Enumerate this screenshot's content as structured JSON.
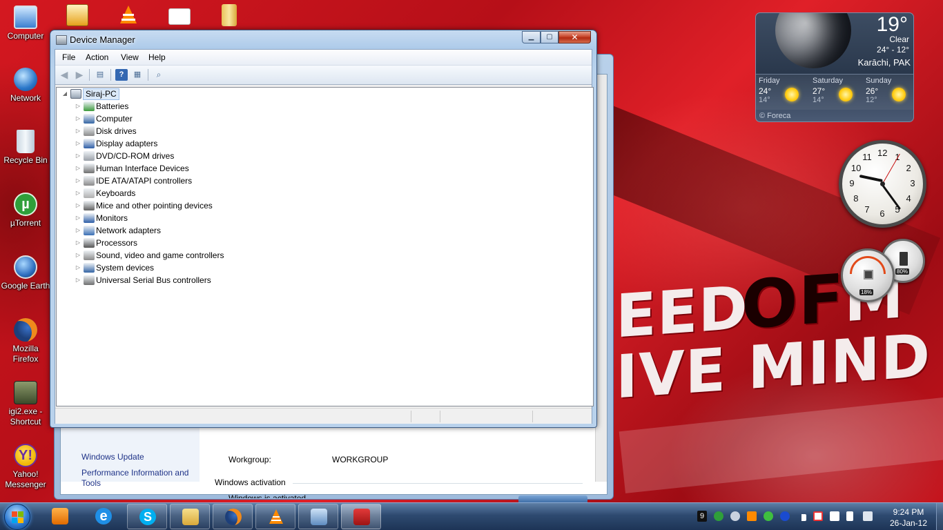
{
  "desktop": {
    "icons": [
      {
        "label": "Computer",
        "icon": "computer-icon"
      },
      {
        "label": "Network",
        "icon": "network-icon"
      },
      {
        "label": "Recycle Bin",
        "icon": "recycle-bin-icon"
      },
      {
        "label": "µTorrent",
        "icon": "utorrent-icon"
      },
      {
        "label": "Google Earth",
        "icon": "google-earth-icon"
      },
      {
        "label": "Mozilla Firefox",
        "icon": "firefox-icon"
      },
      {
        "label": "igi2.exe - Shortcut",
        "icon": "game-shortcut-icon"
      },
      {
        "label": "Yahoo! Messenger",
        "icon": "yahoo-messenger-icon"
      }
    ]
  },
  "device_manager": {
    "title": "Device Manager",
    "menu": [
      "File",
      "Action",
      "View",
      "Help"
    ],
    "root": "Siraj-PC",
    "categories": [
      "Batteries",
      "Computer",
      "Disk drives",
      "Display adapters",
      "DVD/CD-ROM drives",
      "Human Interface Devices",
      "IDE ATA/ATAPI controllers",
      "Keyboards",
      "Mice and other pointing devices",
      "Monitors",
      "Network adapters",
      "Processors",
      "Sound, video and game controllers",
      "System devices",
      "Universal Serial Bus controllers"
    ]
  },
  "system_window": {
    "links": {
      "windows_update": "Windows Update",
      "performance": "Performance Information and Tools"
    },
    "workgroup_label": "Workgroup:",
    "workgroup_value": "WORKGROUP",
    "activation_heading": "Windows activation",
    "activation_status": "Windows is activated"
  },
  "weather": {
    "temp": "19°",
    "condition": "Clear",
    "range": "24° - 12°",
    "city": "Karāchi, PAK",
    "forecast": [
      {
        "day": "Friday",
        "hi": "24°",
        "lo": "14°"
      },
      {
        "day": "Saturday",
        "hi": "27°",
        "lo": "14°"
      },
      {
        "day": "Sunday",
        "hi": "26°",
        "lo": "12°"
      }
    ],
    "credit": "© Foreca"
  },
  "clock": {
    "numbers": [
      "12",
      "1",
      "2",
      "3",
      "4",
      "5",
      "6",
      "7",
      "8",
      "9",
      "10",
      "11"
    ],
    "hour": 9,
    "minute": 24
  },
  "meters": {
    "cpu": "18%",
    "memory": "80%"
  },
  "wallpaper_text": {
    "line1_a": "EED",
    "line1_of": "OF",
    "line1_b": "M",
    "line2": "IVE MIND"
  },
  "taskbar": {
    "tray_counter": "9",
    "time": "9:24 PM",
    "date": "26-Jan-12",
    "colors": {
      "accent": "#1d3456",
      "close_button": "#c8462b"
    }
  }
}
